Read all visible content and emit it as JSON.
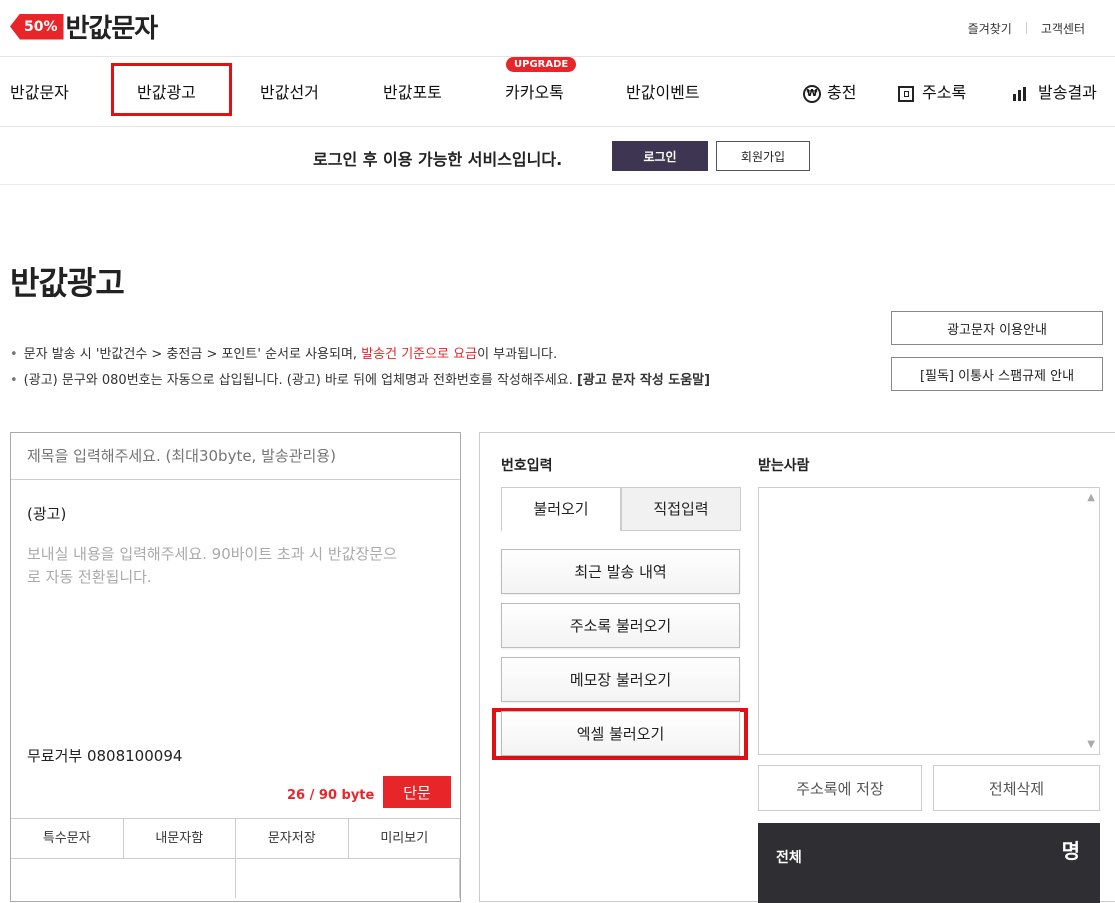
{
  "logo": {
    "badge": "50%",
    "name": "반값문자"
  },
  "utility": {
    "bookmark": "즐겨찾기",
    "support": "고객센터"
  },
  "nav": {
    "items": [
      "반값문자",
      "반값광고",
      "반값선거",
      "반값포토",
      "카카오톡",
      "반값이벤트"
    ],
    "upgrade_badge": "UPGRADE",
    "right": [
      {
        "label": "충전",
        "icon": "won-icon"
      },
      {
        "label": "주소록",
        "icon": "address-book-icon"
      },
      {
        "label": "발송결과",
        "icon": "bar-chart-icon"
      }
    ]
  },
  "login_bar": {
    "message": "로그인 후 이용 가능한 서비스입니다.",
    "login": "로그인",
    "join": "회원가입"
  },
  "page": {
    "title": "반값광고",
    "notice1_a": "문자 발송 시 '반값건수 > 충전금 > 포인트' 순서로 사용되며, ",
    "notice1_red": "발송건 기준으로 요금",
    "notice1_b": "이 부과됩니다.",
    "notice2_a": "(광고) 문구와 080번호는 자동으로 삽입됩니다. (광고) 바로 뒤에 업체명과 전화번호를 작성해주세요. ",
    "notice2_b": "[광고 문자 작성 도움말]",
    "guide_btn": "광고문자 이용안내",
    "spam_btn": "[필독] 이통사 스팸규제 안내"
  },
  "composer": {
    "subject_placeholder": "제목을 입력해주세요. (최대30byte, 발송관리용)",
    "ad_prefix": "(광고)",
    "body_placeholder": "보내실 내용을 입력해주세요. 90바이트 초과 시 반값장문으로 자동 전환됩니다.",
    "reject": "무료거부 0808100094",
    "bytes_used": "26",
    "bytes_total": " / 90 byte",
    "type_badge": "단문",
    "tools": [
      "특수문자",
      "내문자함",
      "문자저장",
      "미리보기"
    ]
  },
  "panel": {
    "number_label": "번호입력",
    "recipients_label": "받는사람",
    "tabs": [
      "불러오기",
      "직접입력"
    ],
    "load_buttons": [
      "최근 발송 내역",
      "주소록 불러오기",
      "메모장 불러오기",
      "엑셀 불러오기"
    ],
    "save_to_book": "주소록에 저장",
    "delete_all": "전체삭제",
    "total_label": "전체",
    "total_unit": "명"
  },
  "colors": {
    "brand_red": "#e8262a",
    "highlight": "#e20f15",
    "dark_button": "#3d3552",
    "total_bg": "#2f2f33"
  }
}
